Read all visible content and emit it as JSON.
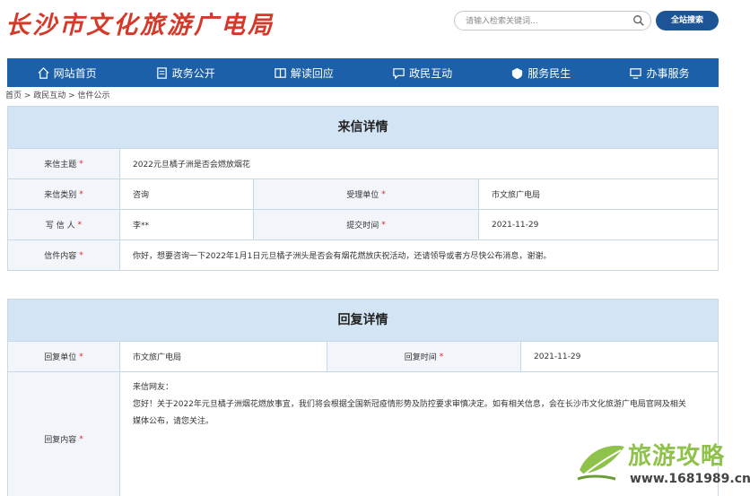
{
  "header": {
    "logo_text": "长沙市文化旅游广电局",
    "search_placeholder": "请输入检索关键词...",
    "search_button": "全站搜索"
  },
  "nav": {
    "items": [
      {
        "label": "网站首页",
        "icon": "home-icon"
      },
      {
        "label": "政务公开",
        "icon": "document-icon"
      },
      {
        "label": "解读回应",
        "icon": "book-icon"
      },
      {
        "label": "政民互动",
        "icon": "chat-icon"
      },
      {
        "label": "服务民生",
        "icon": "service-icon"
      },
      {
        "label": "办事服务",
        "icon": "monitor-icon"
      }
    ]
  },
  "breadcrumb": "首页 > 政民互动 > 信件公示",
  "letter": {
    "title": "来信详情",
    "subject_label": "来信主题",
    "subject_value": "2022元旦橘子洲是否会燃放烟花",
    "category_label": "来信类别",
    "category_value": "咨询",
    "unit_label": "受理单位",
    "unit_value": "市文旅广电局",
    "writer_label": "写 信 人",
    "writer_value": "李**",
    "submit_label": "提交时间",
    "submit_value": "2021-11-29",
    "content_label": "信件内容",
    "content_value": "你好，想要咨询一下2022年1月1日元旦橘子洲头是否会有烟花燃放庆祝活动，还请领导或者方尽快公布消息，谢谢。",
    "required_mark": "*"
  },
  "reply": {
    "title": "回复详情",
    "unit_label": "回复单位",
    "unit_value": "市文旅广电局",
    "time_label": "回复时间",
    "time_value": "2021-11-29",
    "content_label": "回复内容",
    "content_lines": [
      "来信网友：",
      "您好！关于2022年元旦橘子洲烟花燃放事宜，我们将会根据全国新冠疫情形势及防控要求审慎决定。如有相关信息，会在长沙市文化旅游广电局官网及相关",
      "媒体公布，请您关注。"
    ]
  },
  "watermark": {
    "text": "旅游攻略",
    "url": "www.1681989.cn"
  },
  "colors": {
    "nav_bg": "#1b60a8",
    "panel_title_bg": "#d3e5f5",
    "logo": "#d43a2a",
    "required": "#e02020"
  }
}
